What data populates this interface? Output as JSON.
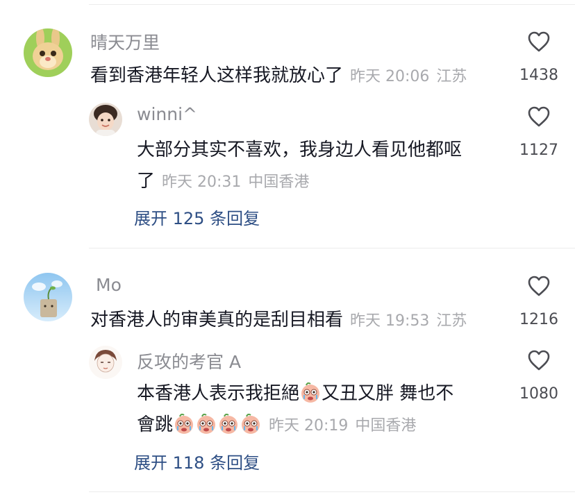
{
  "comments": [
    {
      "username": "晴天万里",
      "text": "看到香港年轻人这样我就放心了",
      "time": "昨天 20:06",
      "location": "江苏",
      "likes": "1438",
      "reply": {
        "username": "winni^",
        "text_line1": "大部分其实不喜欢，我身边人看见他都呕",
        "text_line2": "了",
        "time": "昨天 20:31",
        "location": "中国香港",
        "likes": "1127"
      },
      "expand_label": "展开 125 条回复"
    },
    {
      "username": "Mo",
      "text": "对香港人的审美真的是刮目相看",
      "time": "昨天 19:53",
      "location": "江苏",
      "likes": "1216",
      "reply": {
        "username": "反攻的考官 A",
        "text_line1_a": "本香港人表示我拒絕",
        "text_line1_b": "又丑又胖 舞也不",
        "text_line2": "會跳",
        "time": "昨天 20:19",
        "location": "中国香港",
        "likes": "1080",
        "emoji": "crying-face-emoji"
      },
      "expand_label": "展开 118 条回复"
    }
  ],
  "icons": {
    "like": "heart-outline-icon"
  },
  "colors": {
    "link": "#2d4e84",
    "meta": "#a8a9ad",
    "username": "#8a8b91"
  }
}
